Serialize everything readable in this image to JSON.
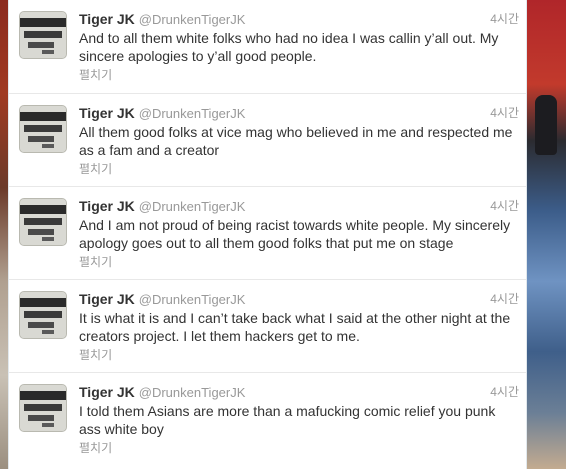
{
  "tweets": [
    {
      "fullname": "Tiger JK",
      "username": "@DrunkenTigerJK",
      "time": "4시간",
      "text": "And to all them white folks who had no idea I was callin y’all out. My sincere apologies to y’all good people.",
      "expand": "펼치기",
      "avatar_icon": "chalkboard-text-avatar"
    },
    {
      "fullname": "Tiger JK",
      "username": "@DrunkenTigerJK",
      "time": "4시간",
      "text": "All them good folks at vice mag who believed in me and respected me as a fam and a creator",
      "expand": "펼치기",
      "avatar_icon": "chalkboard-text-avatar"
    },
    {
      "fullname": "Tiger JK",
      "username": "@DrunkenTigerJK",
      "time": "4시간",
      "text": "And I am not proud of being racist towards white people. My sincerely apology goes out to all them good folks that put me on stage",
      "expand": "펼치기",
      "avatar_icon": "chalkboard-text-avatar"
    },
    {
      "fullname": "Tiger JK",
      "username": "@DrunkenTigerJK",
      "time": "4시간",
      "text": "It is what it is and I can’t take back what I said at the other night at the creators project. I let them hackers get to me.",
      "expand": "펼치기",
      "avatar_icon": "chalkboard-text-avatar"
    },
    {
      "fullname": "Tiger JK",
      "username": "@DrunkenTigerJK",
      "time": "4시간",
      "text": "I told them Asians are more than a mafucking comic relief you punk ass white boy",
      "expand": "펼치기",
      "avatar_icon": "chalkboard-text-avatar"
    }
  ]
}
